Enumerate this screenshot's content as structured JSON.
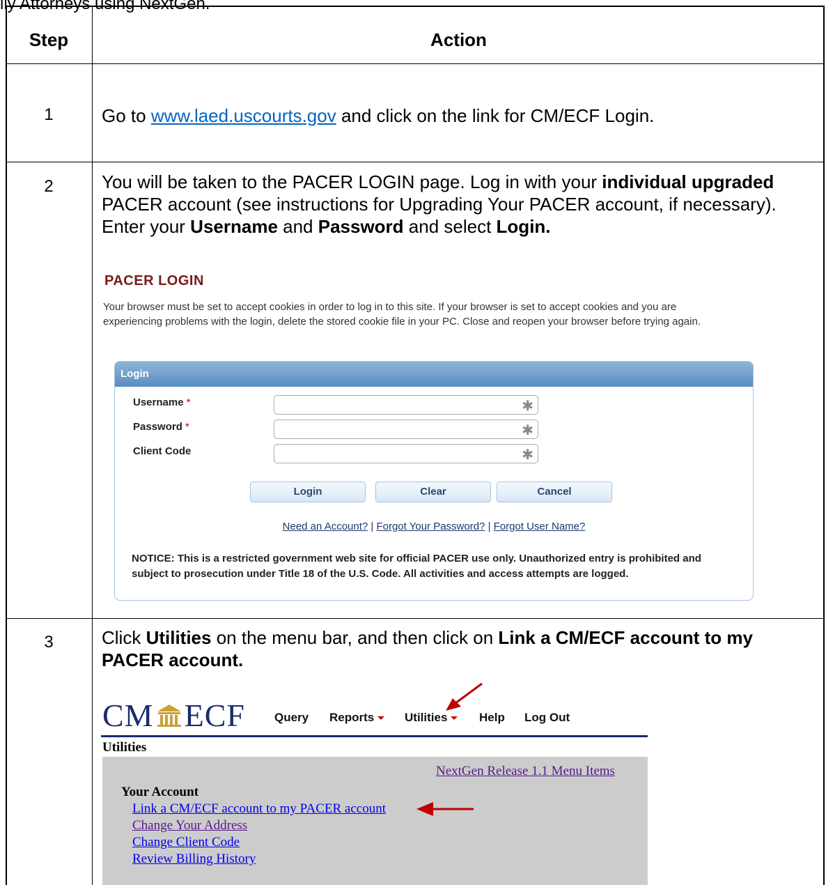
{
  "top_text": "ily Attorneys using NextGen.",
  "headers": {
    "step": "Step",
    "action": "Action"
  },
  "steps": [
    {
      "num": "1",
      "text_before": "Go to ",
      "link": "www.laed.uscourts.gov",
      "text_after": " and click on the link for CM/ECF Login."
    },
    {
      "num": "2",
      "p1": "You will be taken to the PACER LOGIN page. Log in with your ",
      "b1": "individual upgraded",
      "p2": " PACER account (see instructions for Upgrading Your PACER account, if necessary). Enter your ",
      "b2": "Username",
      "p3": " and ",
      "b3": "Password",
      "p4": " and select ",
      "b4": "Login."
    },
    {
      "num": "3",
      "p1": "Click ",
      "b1": "Utilities",
      "p2": " on the menu bar, and then click on ",
      "b2": "Link a CM/ECF account to my PACER account."
    }
  ],
  "pacer": {
    "title": "PACER LOGIN",
    "notice": "Your browser must be set to accept cookies in order to log in to this site. If your browser is set to accept cookies and you are experiencing problems with the login, delete the stored cookie file in your PC. Close and reopen your browser before trying again.",
    "box_title": "Login",
    "fields": [
      {
        "label": "Username",
        "required": "*"
      },
      {
        "label": "Password",
        "required": "*"
      },
      {
        "label": "Client Code",
        "required": ""
      }
    ],
    "input_marker": "✱",
    "buttons": {
      "login": "Login",
      "clear": "Clear",
      "cancel": "Cancel"
    },
    "links": {
      "need_account": "Need an Account?",
      "forgot_password": "Forgot Your Password?",
      "forgot_username": "Forgot User Name?",
      "separator": " | "
    },
    "restricted": "NOTICE: This is a restricted government web site for official PACER use only. Unauthorized entry is prohibited and subject to prosecution under Title 18 of the U.S. Code. All activities and access attempts are logged."
  },
  "cmecf": {
    "logo_left": "CM",
    "logo_right": "ECF",
    "menu": {
      "query": "Query",
      "reports": "Reports",
      "utilities": "Utilities",
      "help": "Help",
      "logout": "Log Out"
    },
    "page_title": "Utilities",
    "nextgen_link": "NextGen Release 1.1 Menu Items",
    "section": "Your Account",
    "links": [
      "Link a CM/ECF account to my PACER account",
      "Change Your Address",
      "Change Client Code",
      "Review Billing History"
    ]
  },
  "colors": {
    "pacer_title": "#7a1a1a",
    "login_bar": "#5a8cc0",
    "cmecf_navy": "#1a2b6b",
    "arrow_red": "#c00000",
    "visited_link": "#551a8b",
    "unvisited_link": "#0000ee"
  }
}
